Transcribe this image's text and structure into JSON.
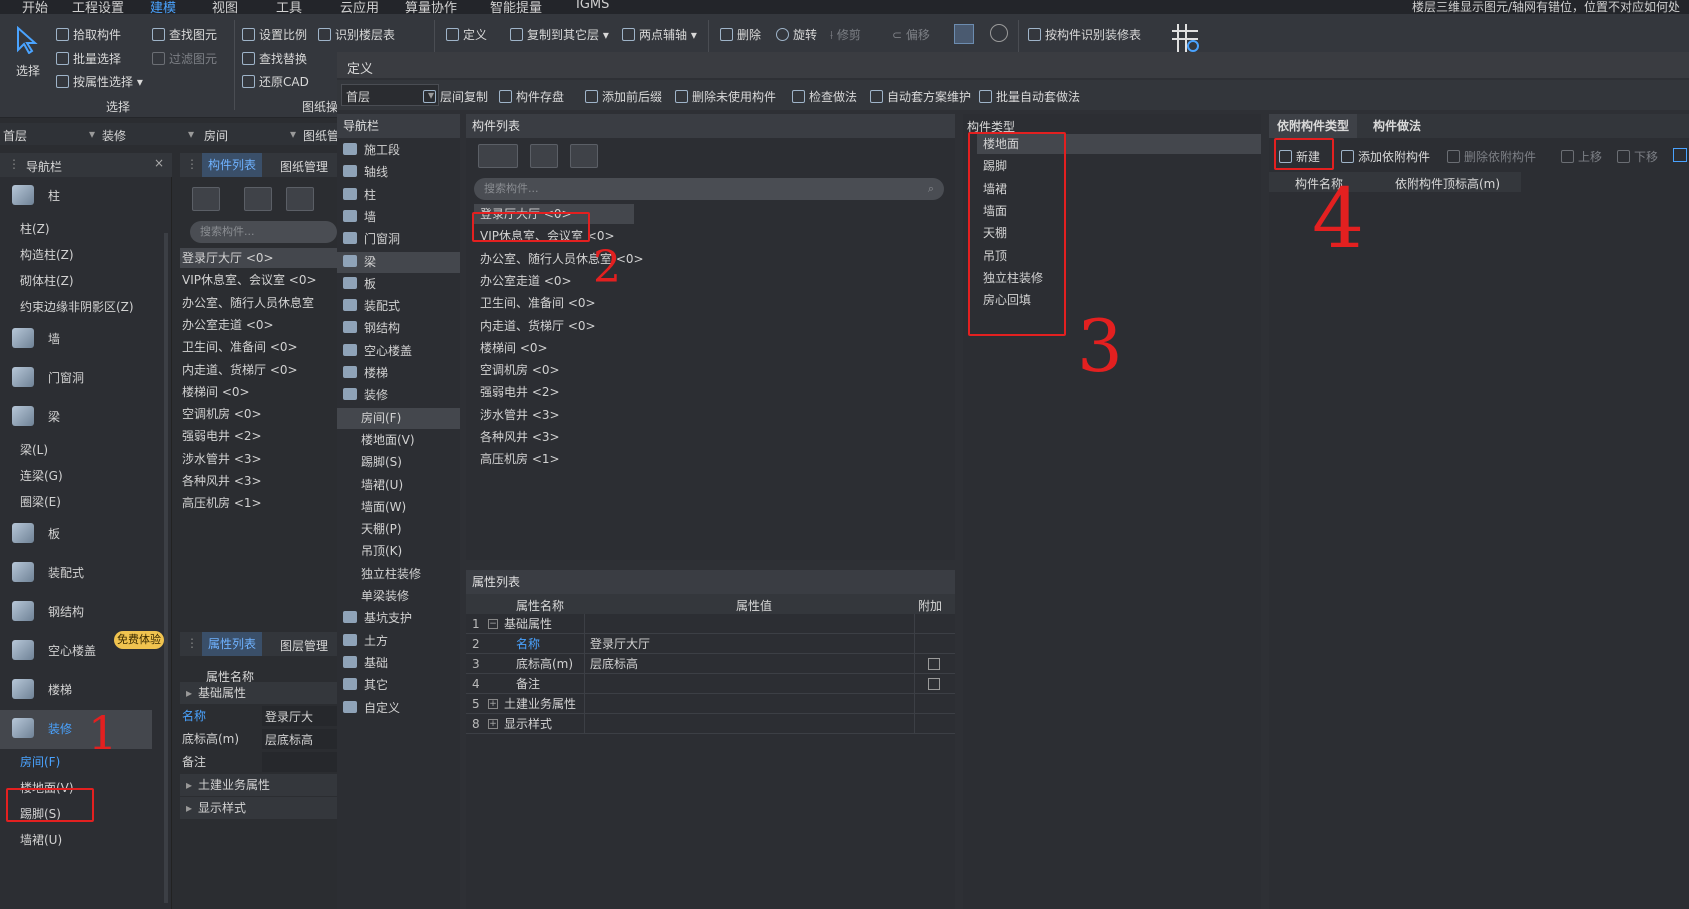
{
  "menu": {
    "items": [
      "开始",
      "工程设置",
      "建模",
      "视图",
      "工具",
      "云应用",
      "算量协作",
      "智能提量",
      "IGMS"
    ],
    "notice": "楼层三维显示图元/轴网有错位，位置不对应如何处理"
  },
  "ribbon": {
    "select_label": "选择",
    "select_group": "选择",
    "pick_component": "拾取构件",
    "batch_select": "批量选择",
    "select_by_attr": "按属性选择",
    "find_element": "查找图元",
    "filter_element": "过滤图元",
    "set_scale": "设置比例",
    "identify_floor_table": "识别楼层表",
    "find_replace": "查找替换",
    "restore_cad": "还原CAD",
    "drawing_group": "图纸操",
    "define": "定义",
    "copy_to_other_floor": "复制到其它层",
    "two_point_axis": "两点辅轴",
    "delete": "删除",
    "rotate": "旋转",
    "trim": "修剪",
    "offset": "偏移",
    "identify_decoration_table": "按构件识别装修表"
  },
  "filters": {
    "floor": "首层",
    "category": "装修",
    "type": "房间",
    "drawing": "图纸管"
  },
  "left_nav": {
    "title": "导航栏",
    "items": [
      {
        "label": "柱",
        "big": true
      },
      {
        "label": "柱(Z)"
      },
      {
        "label": "构造柱(Z)"
      },
      {
        "label": "砌体柱(Z)"
      },
      {
        "label": "约束边缘非阴影区(Z)"
      },
      {
        "label": "墙",
        "big": true
      },
      {
        "label": "门窗洞",
        "big": true
      },
      {
        "label": "梁",
        "big": true
      },
      {
        "label": "梁(L)"
      },
      {
        "label": "连梁(G)"
      },
      {
        "label": "圈梁(E)"
      },
      {
        "label": "板",
        "big": true
      },
      {
        "label": "装配式",
        "big": true
      },
      {
        "label": "钢结构",
        "big": true
      },
      {
        "label": "空心楼盖",
        "big": true
      },
      {
        "label": "楼梯",
        "big": true
      },
      {
        "label": "装修",
        "big": true,
        "active": true
      },
      {
        "label": "房间(F)",
        "active": true
      },
      {
        "label": "楼地面(V)"
      },
      {
        "label": "踢脚(S)"
      },
      {
        "label": "墙裙(U)"
      }
    ],
    "free_badge": "免费体验"
  },
  "mid_panel": {
    "tabs": [
      "构件列表",
      "图纸管理"
    ],
    "search_placeholder": "搜索构件...",
    "items": [
      "登录厅大厅 <0>",
      "VIP休息室、会议室 <0>",
      "办公室、随行人员休息室",
      "办公室走道 <0>",
      "卫生间、准备间 <0>",
      "内走道、货梯厅 <0>",
      "楼梯间 <0>",
      "空调机房 <0>",
      "强弱电井 <2>",
      "涉水管井 <3>",
      "各种风井 <3>",
      "高压机房 <1>"
    ],
    "attr_tabs": [
      "属性列表",
      "图层管理"
    ],
    "attr_header": "属性名称",
    "attr_rows": [
      {
        "label": "基础属性",
        "group": true
      },
      {
        "label": "名称",
        "value": "登录厅大",
        "blue": true
      },
      {
        "label": "底标高(m)",
        "value": "层底标高"
      },
      {
        "label": "备注",
        "value": ""
      },
      {
        "label": "土建业务属性",
        "group": true
      },
      {
        "label": "显示样式",
        "group": true
      }
    ]
  },
  "define": {
    "title": "定义",
    "floor": "首层",
    "toolbar": [
      "层间复制",
      "构件存盘",
      "添加前后缀",
      "删除未使用构件",
      "检查做法",
      "自动套方案维护",
      "批量自动套做法"
    ],
    "nav_title": "导航栏",
    "nav_items": [
      "施工段",
      "轴线",
      "柱",
      "墙",
      "门窗洞",
      "梁",
      "板",
      "装配式",
      "钢结构",
      "空心楼盖",
      "楼梯",
      "装修",
      "房间(F)",
      "楼地面(V)",
      "踢脚(S)",
      "墙裙(U)",
      "墙面(W)",
      "天棚(P)",
      "吊顶(K)",
      "独立柱装修",
      "单梁装修",
      "基坑支护",
      "土方",
      "基础",
      "其它",
      "自定义"
    ],
    "comp_title": "构件列表",
    "comp_search": "搜索构件...",
    "comp_items": [
      "登录厅大厅 <0>",
      "VIP休息室、会议室 <0>",
      "办公室、随行人员休息室 <0>",
      "办公室走道 <0>",
      "卫生间、准备间 <0>",
      "内走道、货梯厅 <0>",
      "楼梯间 <0>",
      "空调机房 <0>",
      "强弱电井 <2>",
      "涉水管井 <3>",
      "各种风井 <3>",
      "高压机房 <1>"
    ],
    "type_title": "构件类型",
    "type_items": [
      "楼地面",
      "踢脚",
      "墙裙",
      "墙面",
      "天棚",
      "吊顶",
      "独立柱装修",
      "房心回填"
    ],
    "attr_title": "属性列表",
    "attr_cols": [
      "属性名称",
      "属性值",
      "附加"
    ],
    "attr_rows": [
      {
        "no": "1",
        "name": "基础属性",
        "value": "",
        "group": true
      },
      {
        "no": "2",
        "name": "名称",
        "value": "登录厅大厅",
        "blue": true
      },
      {
        "no": "3",
        "name": "底标高(m)",
        "value": "层底标高",
        "check": true
      },
      {
        "no": "4",
        "name": "备注",
        "value": "",
        "check": true
      },
      {
        "no": "5",
        "name": "土建业务属性",
        "value": "",
        "group": true
      },
      {
        "no": "8",
        "name": "显示样式",
        "value": "",
        "group": true
      }
    ],
    "dep_tabs": [
      "依附构件类型",
      "构件做法"
    ],
    "dep_toolbar": {
      "new": "新建",
      "add": "添加依附构件",
      "remove": "删除依附构件",
      "up": "上移",
      "down": "下移"
    },
    "dep_cols": [
      "构件名称",
      "依附构件顶标高(m)"
    ]
  },
  "annotations": [
    "1",
    "2",
    "3",
    "4"
  ]
}
